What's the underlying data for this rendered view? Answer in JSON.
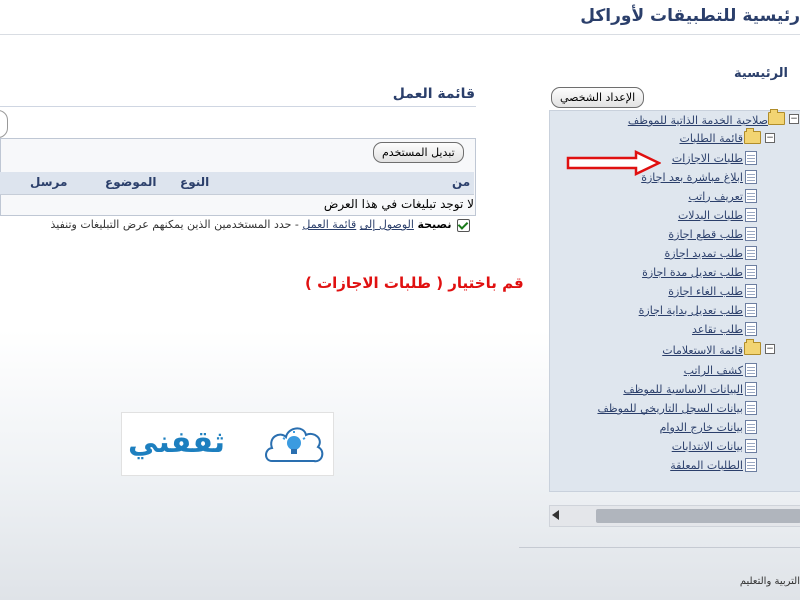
{
  "header": {
    "app_title": "رئيسية للتطبيقات لأوراكل",
    "home_label": "الرئيسية"
  },
  "buttons": {
    "personal_settings": "الإعداد الشخصي",
    "change_user": "تبديل المستخدم"
  },
  "worklist": {
    "title": "قائمة العمل",
    "columns": [
      "من",
      "النوع",
      "الموضوع",
      "مرسل"
    ],
    "empty_message": "لا توجد تبليغات في هذا العرض",
    "tip_label": "نصيحة",
    "tip_link_1": "الوصول إلى",
    "tip_link_2": "قائمة العمل",
    "tip_text": "- حدد المستخدمين الذين يمكنهم عرض التبليغات وتنفيذ"
  },
  "instruction": "قم باختيار ( طلبات الاجازات )",
  "logo": {
    "text": "ثقفني"
  },
  "tree": {
    "root": "صلاحية الخدمة الذاتية للموظف",
    "folder_requests": "قائمة الطلبات",
    "requests": [
      "طلبات الاجازات",
      "ابلاغ مباشرة بعد اجازة",
      "تعريف راتب",
      "طلبات البدلات",
      "طلب قطع اجازة",
      "طلب تمديد اجازة",
      "طلب تعديل مدة اجازة",
      "طلب الغاء اجازة",
      "طلب تعديل بداية اجازة",
      "طلب تقاعد"
    ],
    "folder_inquiries": "قائمة الاستعلامات",
    "inquiries": [
      "كشف الراتب",
      "البيانات الاساسية للموظف",
      "بيانات السجل التاريخي للموظف",
      "بيانات خارج الدوام",
      "بيانات الانتدابات",
      "الطلبات المعلقة"
    ]
  },
  "footer": {
    "text": "التربية والتعليم"
  },
  "colors": {
    "accent": "#2b3f6b",
    "instruction": "#e01010",
    "logo": "#1d7fbf",
    "tree_bg": "#dfe6ee"
  }
}
